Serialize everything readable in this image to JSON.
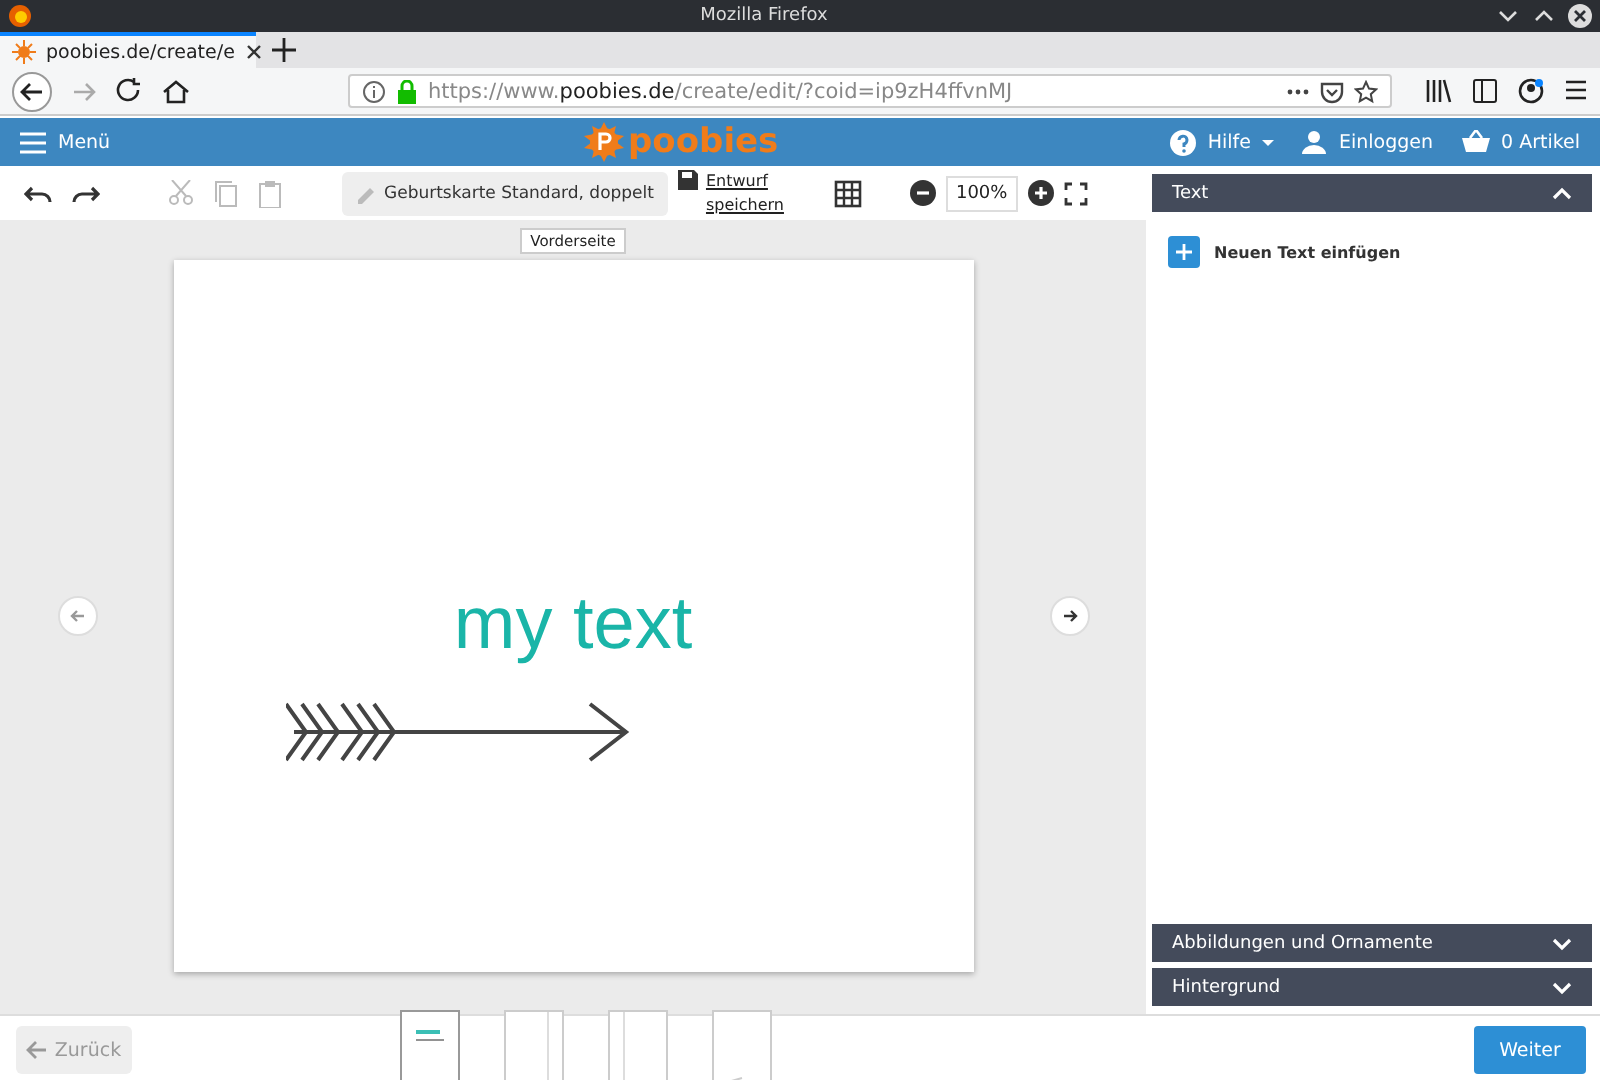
{
  "window": {
    "title": "Mozilla Firefox"
  },
  "browser": {
    "tab_title": "poobies.de/create/e",
    "url_prefix": "https://www.",
    "url_domain": "poobies.de",
    "url_path": "/create/edit/?coid=ip9zH4ffvnMJ"
  },
  "header": {
    "menu": "Menü",
    "logo": "poobies",
    "help": "Hilfe",
    "login": "Einloggen",
    "cart": "0 Artikel"
  },
  "toolbar": {
    "product": "Geburtskarte Standard, doppelt",
    "save": "Entwurf speichern",
    "zoom": "100%"
  },
  "page_label": "Vorderseite",
  "canvas": {
    "text": "my text"
  },
  "panel": [
    {
      "title": "Text",
      "expanded": true,
      "action": "Neuen Text einfügen"
    },
    {
      "title": "Abbildungen und Ornamente",
      "expanded": false
    },
    {
      "title": "Hintergrund",
      "expanded": false
    }
  ],
  "pages": [
    {
      "selected": true,
      "kind": "front"
    },
    {
      "selected": false,
      "kind": "inner-right"
    },
    {
      "selected": false,
      "kind": "inner-left"
    },
    {
      "selected": false,
      "kind": "back"
    }
  ],
  "buttons": {
    "back": "Zurück",
    "back_disabled": true,
    "next": "Weiter"
  }
}
